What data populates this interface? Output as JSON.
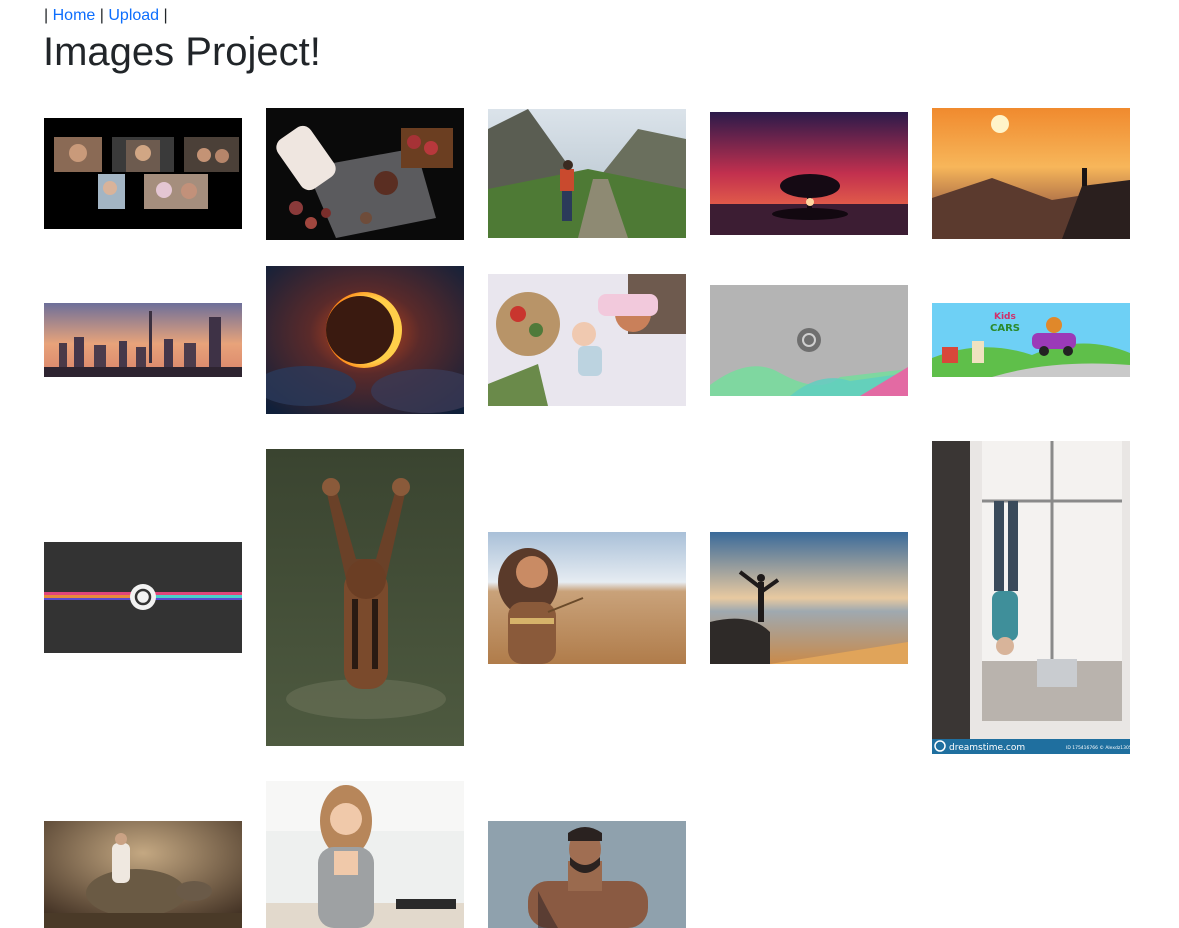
{
  "nav": {
    "sep1": "|",
    "home": "Home",
    "sep2": "|",
    "upload": "Upload",
    "sep3": "|"
  },
  "page": {
    "title": "Images Project!"
  },
  "colors": {
    "link": "#0d6efd",
    "text": "#212529"
  },
  "gallery": {
    "images": [
      {
        "name": "video-call-photo",
        "subject": "video call grid"
      },
      {
        "name": "wine-picnic-photo",
        "subject": "wine and fruit"
      },
      {
        "name": "mountain-hiker-photo",
        "subject": "hiker in valley"
      },
      {
        "name": "tree-sunset-photo",
        "subject": "tree at red sunset"
      },
      {
        "name": "mountain-sunrise-photo",
        "subject": "sunrise over mountains"
      },
      {
        "name": "city-skyline-photo",
        "subject": "city skyline at dusk"
      },
      {
        "name": "solar-eclipse-photo",
        "subject": "eclipse"
      },
      {
        "name": "family-picnic-photo",
        "subject": "family picnic"
      },
      {
        "name": "ubuntu-wallpaper-gray",
        "subject": "ubuntu wallpaper"
      },
      {
        "name": "kids-cars-banner",
        "subject": "kids cars game",
        "caption_top": "Kids",
        "caption_bottom": "CARS"
      },
      {
        "name": "ubuntu-wallpaper-dark",
        "subject": "ubuntu wallpaper dark"
      },
      {
        "name": "tiger-water-photo",
        "subject": "tiger splashing"
      },
      {
        "name": "woman-desert-photo",
        "subject": "woman in desert"
      },
      {
        "name": "beach-yoga-photo",
        "subject": "yoga on beach"
      },
      {
        "name": "handstand-window-photo",
        "subject": "handstand by window",
        "watermark": "dreamstime.com",
        "stock_id": "ID 175416766 © Alexdz1305"
      },
      {
        "name": "turtle-fantasy-photo",
        "subject": "girl on tortoise"
      },
      {
        "name": "woman-kitchen-photo",
        "subject": "woman in kitchen"
      },
      {
        "name": "tattooed-man-photo",
        "subject": "tattooed man"
      }
    ]
  }
}
